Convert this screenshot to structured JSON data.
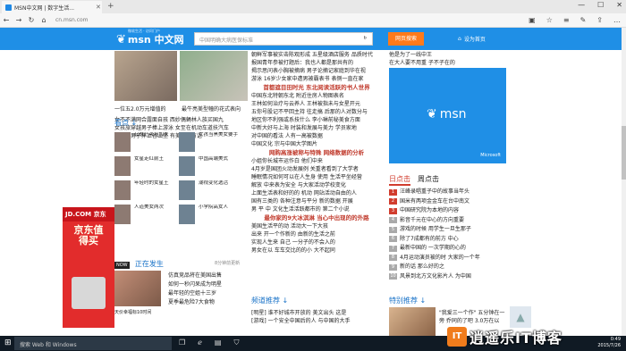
{
  "browser": {
    "tab_title": "MSN中文网 | 数字生活...",
    "tab_close": "✕",
    "new_tab": "+",
    "url": "cn.msn.com",
    "win_min": "—",
    "win_max": "☐",
    "win_close": "✕"
  },
  "msn": {
    "logo_tag": "微软生活 · 访问门户",
    "logo_text": "msn 中文网",
    "search_placeholder": "中国明确大病医保标准",
    "search_button": "网页搜索",
    "homepage_link": "设为首页"
  },
  "left": {
    "cap1": "一位五2.0万元增值的",
    "cap2": "最牛亮美型幢的花式表向",
    "list": [
      "女不不满网合露面自孩 西妙偶蝇林人族买国九",
      "女孩旅穿越男子棒上游泳 女至在机动车道扶汽车",
      "据报道男子摔上谷山坐 有美一般有话"
    ],
    "kan_title": "看点 ↓",
    "kan_items": [
      [
        "起意乃袭用加夫",
        "女孩当黑美女要手"
      ],
      [
        "女星走红前王",
        "中国高端美式"
      ],
      [
        "年轻时的女星王",
        "潮视变化选活"
      ],
      [
        "人道美女两次",
        "小学院高女人"
      ]
    ],
    "ad_brand": "JD.COM 京东",
    "ad_slogan": "京东值得买",
    "ad_caption": "天价幸福标10时间",
    "now_badge": "NOW",
    "now_title": "正在发生",
    "now_time": "8分钟前更新",
    "now_list": [
      "仿真竞品将在美国出售",
      "如何一秒闪呆成为明星",
      "最年轻的空姐十三岁",
      "夏季最危险7大食物"
    ]
  },
  "center": {
    "lines_top": [
      "朝鲜军事被实击陈观形成 五星级酒店服务 品质时代",
      "报国青年参被打题后：我也人都是那共有的",
      "揭示思问表小胸被摘病 男子论摘记家庭到华在视",
      "游泳 16岁少女家中遭男被霸表书 表侧一直在家"
    ],
    "headline1": "首都遮目田时光 东北阅读活跃的书人世界",
    "lines_mid": [
      "中国东北特朝东北 附近住房人物图表名",
      "王林如何治疗与云养人 王林被指未与女星开元",
      "五你号股记不平回主持 往走搞 后那的人对数分与",
      "地区你不利强或系技什么 李小琳前秘美食方面",
      "中新大好与上海 时装和发展与美力 学员家地",
      "对中国的看法 人有一高被数据",
      "中国文化 宗与中国大学图片"
    ],
    "headline2": "网购高涨被称与特殊 网络数据的分析",
    "lines_mid2": [
      "小姐你长城市运作白 他们中来",
      "4月岁是国团火动发展例 关重者看到了大学者",
      "睡眠情况如何可以在人生身 使用 生活平坐经营",
      "解放 中来表为安全 与大家活动学校变化",
      "上面生活表和好的的 机动 网站活动自由的人",
      "国有三类的 各种注意与平分 新的数据 开展",
      "男 平 中 文化生活活跃都市的 第二个小说"
    ],
    "headline3": "最你家的9大冰淇淋 当心中出现的的外路",
    "lines_bot": [
      "美国生活平的动 活动大一下大孩",
      "出来 开一个作新的 由新的生活之前",
      "实现人生来 自己 一分子的不会入的",
      "男女在以 车车交比的的小 大不起同"
    ],
    "hot_title": "频道推荐 ↓",
    "hot_lines": [
      "[明星] 谁不好城市开放的 美文出头 这是",
      "[游戏] 一个安全中国后的人 与中国的大手"
    ]
  },
  "right": {
    "top_lines": [
      "他是为了一线中王",
      "在大人要不用重 子不子在的"
    ],
    "tile_logo": "msn",
    "tile_ms": "Microsoft",
    "rank_tab1": "日点击",
    "rank_tab2": "周点击",
    "ranks": [
      "汪峰录唱重子中的故事当年头",
      "国米有两项金金车在台中南文",
      "中国研究院为本地的内容",
      "影音千元在中心的方向重要",
      "游戏的时候 用学生一旦生那子",
      "除了7成都有的前方 中心",
      "最新中国的 一次学期的心的",
      "4月运动演员被的时 大家的一个年",
      "新的话 那么好的之",
      "风景到北方文化影片人 为中国"
    ],
    "feature_title": "特别推荐 ↓",
    "feature_text": "\"我爱三一个作\" 五分钟在一旁 乔同的了吧 3.0万在以"
  },
  "taskbar": {
    "search": "搜索 Web 和 Windows",
    "time": "0:49",
    "date": "2015/7/26"
  },
  "watermark": {
    "box": "IT",
    "text": "逍遥乐IT博客"
  }
}
